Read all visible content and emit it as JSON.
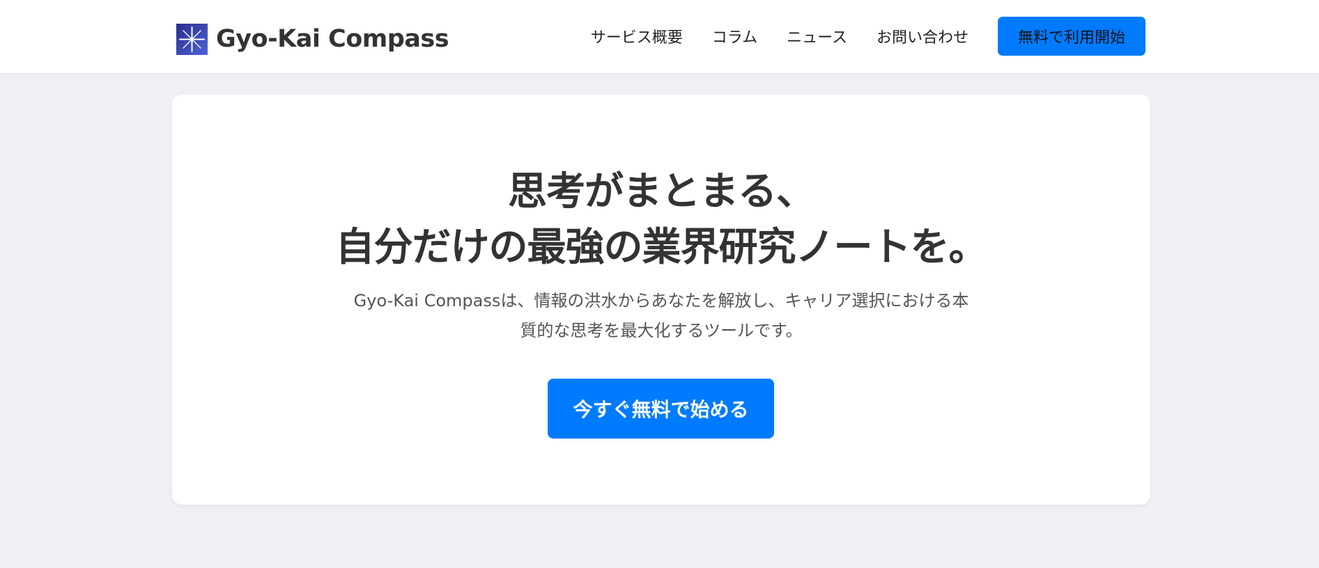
{
  "header": {
    "logo_icon": "compass-star-icon",
    "logo_text": "Gyo-Kai Compass",
    "nav": [
      {
        "label": "サービス概要"
      },
      {
        "label": "コラム"
      },
      {
        "label": "ニュース"
      },
      {
        "label": "お問い合わせ"
      }
    ],
    "cta_label": "無料で利用開始"
  },
  "hero": {
    "title_line1": "思考がまとまる、",
    "title_line2": "自分だけの最強の業界研究ノートを。",
    "description": "Gyo-Kai Compassは、情報の洪水からあなたを解放し、キャリア選択における本質的な思考を最大化するツールです。",
    "cta_label": "今すぐ無料で始める"
  },
  "colors": {
    "accent": "#007bff",
    "background": "#eff0f3",
    "card": "#ffffff",
    "text": "#333333",
    "logo_gradient_start": "#2f2f8f",
    "logo_gradient_end": "#4a5ed6"
  }
}
